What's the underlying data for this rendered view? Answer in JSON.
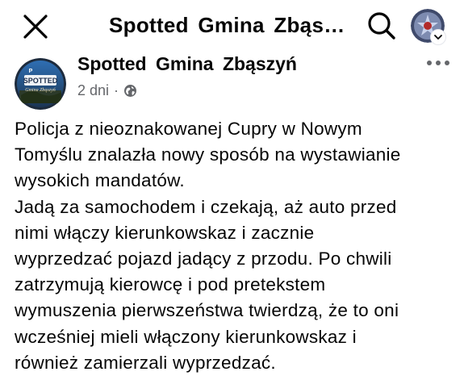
{
  "header": {
    "title": "Spotted  Gmina  Zbąsz..."
  },
  "post": {
    "page_name": "Spotted  Gmina  Zbąszyń",
    "time": "2 dni",
    "separator": "·",
    "avatar_text": {
      "brand": "SPOTTED",
      "place": "Gmina Zbąszyń"
    },
    "lines": [
      "Policja z nieoznakowanej Cupry w Nowym",
      "Tomyślu znalazła nowy sposób na wystawianie",
      "wysokich mandatów.",
      "Jadą za samochodem i czekają, aż auto przed",
      "nimi włączy kierunkowskaz i zacznie",
      "wyprzedzać pojazd jadący z przodu. Po chwili",
      "zatrzymują kierowcę i pod pretekstem",
      "wymuszenia pierwszeństwa twierdzą, że to oni",
      "wcześniej mieli włączony kierunkowskaz i",
      "również zamierzali wyprzedzać."
    ]
  },
  "icons": {
    "close": "close-icon",
    "search": "search-icon",
    "more": "more-horizontal-icon",
    "audience": "globe-icon",
    "chevron": "chevron-down-icon"
  },
  "colors": {
    "text_primary": "#050505",
    "text_secondary": "#65676b",
    "background": "#ffffff"
  }
}
